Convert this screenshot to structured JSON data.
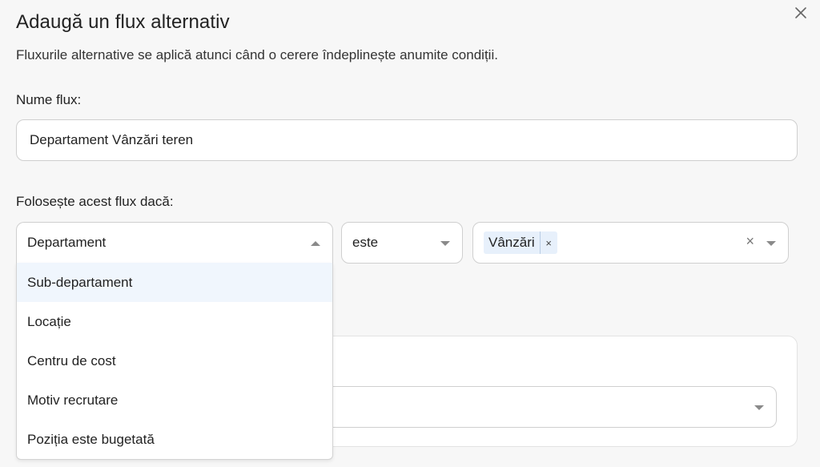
{
  "dialog": {
    "title": "Adaugă un flux alternativ",
    "subtitle": "Fluxurile alternative se aplică atunci când o cerere îndeplinește anumite condiții.",
    "close_icon": "close-icon"
  },
  "name_field": {
    "label": "Nume flux:",
    "value": "Departament Vânzări teren"
  },
  "condition": {
    "label": "Folosește acest flux dacă:",
    "field_select": {
      "value": "Departament",
      "state": "open"
    },
    "operator_select": {
      "value": "este"
    },
    "value_select": {
      "tags": [
        {
          "label": "Vânzări",
          "remove": "×"
        }
      ],
      "clear": "×"
    },
    "dropdown_options": [
      {
        "label": "Sub-departament",
        "highlighted": true
      },
      {
        "label": "Locație",
        "highlighted": false
      },
      {
        "label": "Centru de cost",
        "highlighted": false
      },
      {
        "label": "Motiv recrutare",
        "highlighted": false
      },
      {
        "label": "Poziția este bugetată",
        "highlighted": false
      }
    ]
  },
  "colors": {
    "background": "#f7f7f7",
    "border": "#cfcfcf",
    "highlight": "#f0f6fd",
    "tag_bg": "#e7f0fb",
    "caret": "#8a8a8a"
  }
}
